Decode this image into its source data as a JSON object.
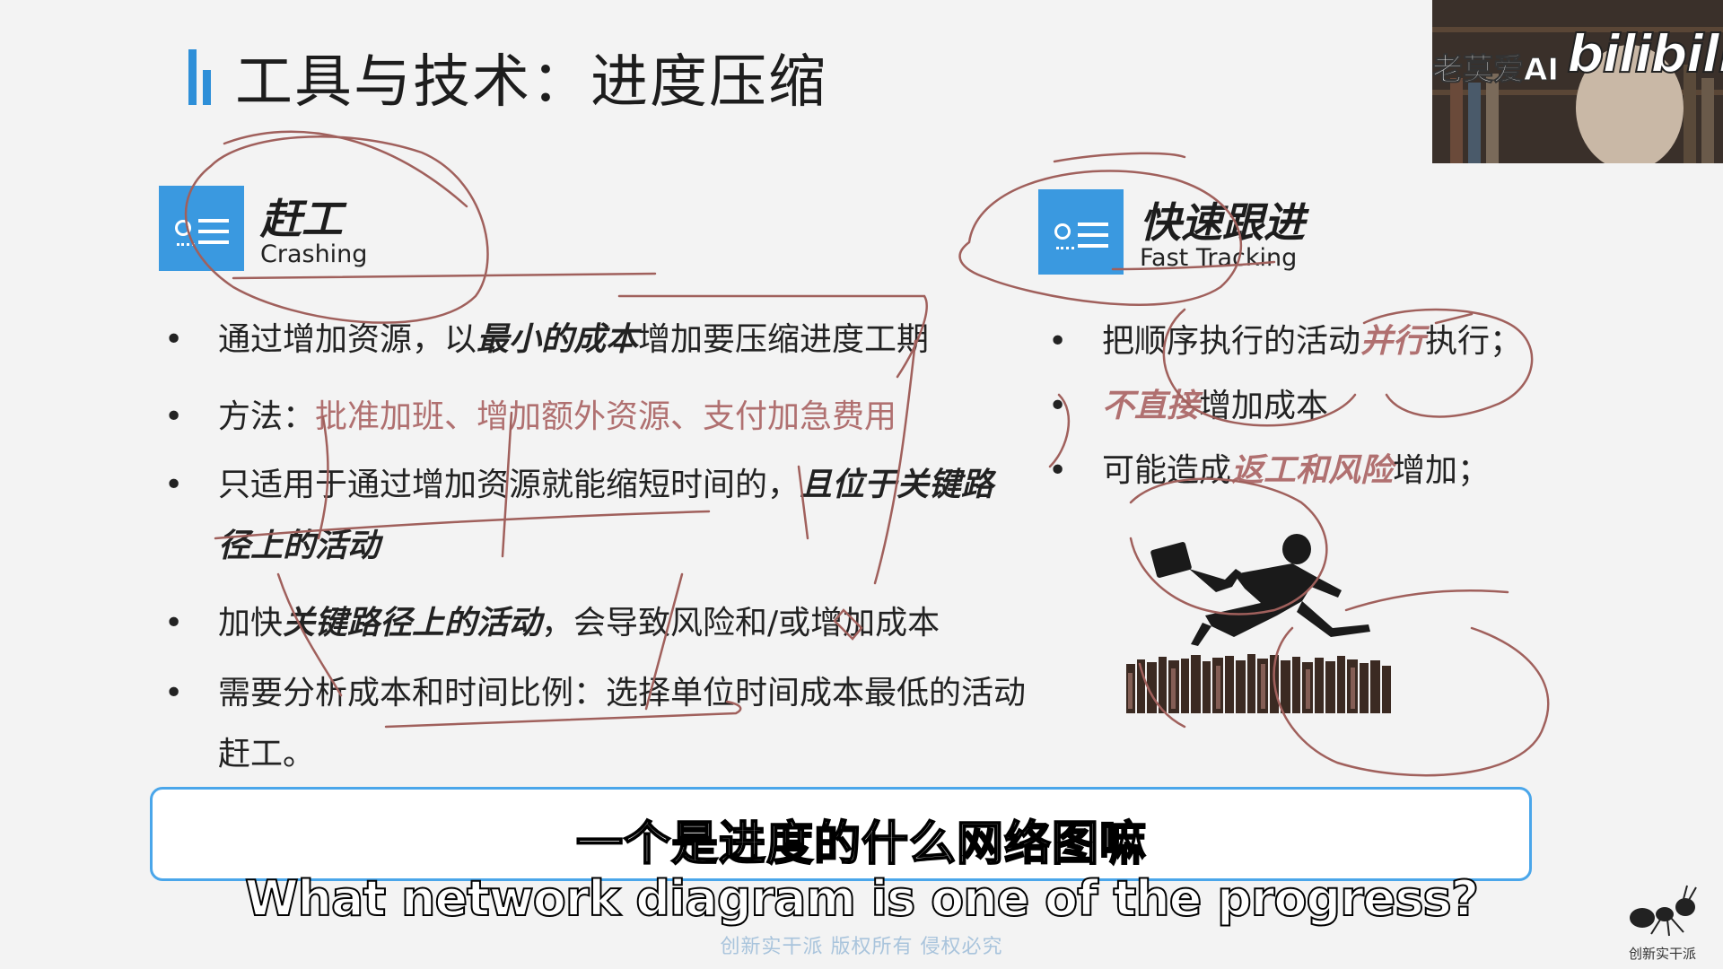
{
  "slide": {
    "title": "工具与技术：进度压缩",
    "left_section": {
      "title": "赶工",
      "subtitle": "Crashing",
      "icon": "chart-list-icon",
      "bullets": [
        {
          "segments": [
            {
              "t": "通过增加资源，以"
            },
            {
              "t": "最小的成本",
              "emph": true
            },
            {
              "t": "增加要压缩进度工期"
            }
          ]
        },
        {
          "segments": [
            {
              "t": "方法："
            },
            {
              "t": "批准加班、增加额外资源、支付加急费用",
              "accent": true
            }
          ]
        },
        {
          "segments": [
            {
              "t": "只适用于通过增加资源就能缩短时间的，"
            },
            {
              "t": "且位于关键路径上的活动",
              "emph": true
            }
          ]
        },
        {
          "segments": [
            {
              "t": "加快"
            },
            {
              "t": "关键路径上的活动",
              "emph": true
            },
            {
              "t": "，会导致风险和/或增加成本"
            }
          ]
        },
        {
          "segments": [
            {
              "t": "需要分析成本和时间比例：选择单位时间成本最低的活动赶工。"
            }
          ]
        }
      ]
    },
    "right_section": {
      "title": "快速跟进",
      "subtitle": "Fast Tracking",
      "icon": "chart-list-icon",
      "bullets": [
        {
          "segments": [
            {
              "t": "把顺序执行的活动"
            },
            {
              "t": "并行",
              "emph": true,
              "accent": true
            },
            {
              "t": "执行；"
            }
          ]
        },
        {
          "segments": [
            {
              "t": "不直接",
              "emph": true,
              "accent": true
            },
            {
              "t": "增加成本"
            }
          ]
        },
        {
          "segments": [
            {
              "t": "可能造成"
            },
            {
              "t": "返工和风险",
              "emph": true,
              "accent": true
            },
            {
              "t": "增加；"
            }
          ]
        }
      ],
      "image": "businessman-jumping-over-books-image"
    }
  },
  "overlay": {
    "uploader_name": "老莫爱AI",
    "brand": "bilibili",
    "subtitle_zh": "一个是进度的什么网络图嘛",
    "subtitle_en": "What network diagram is one of the progress?",
    "copyright": "创新实干派  版权所有  侵权必究",
    "watermark_logo_text": "创新实干派"
  },
  "colors": {
    "accent_blue": "#3a99e0",
    "annotation_ink": "#a0605c",
    "accent_text": "#b07070",
    "subtitle_box_border": "#4aa6ea"
  }
}
